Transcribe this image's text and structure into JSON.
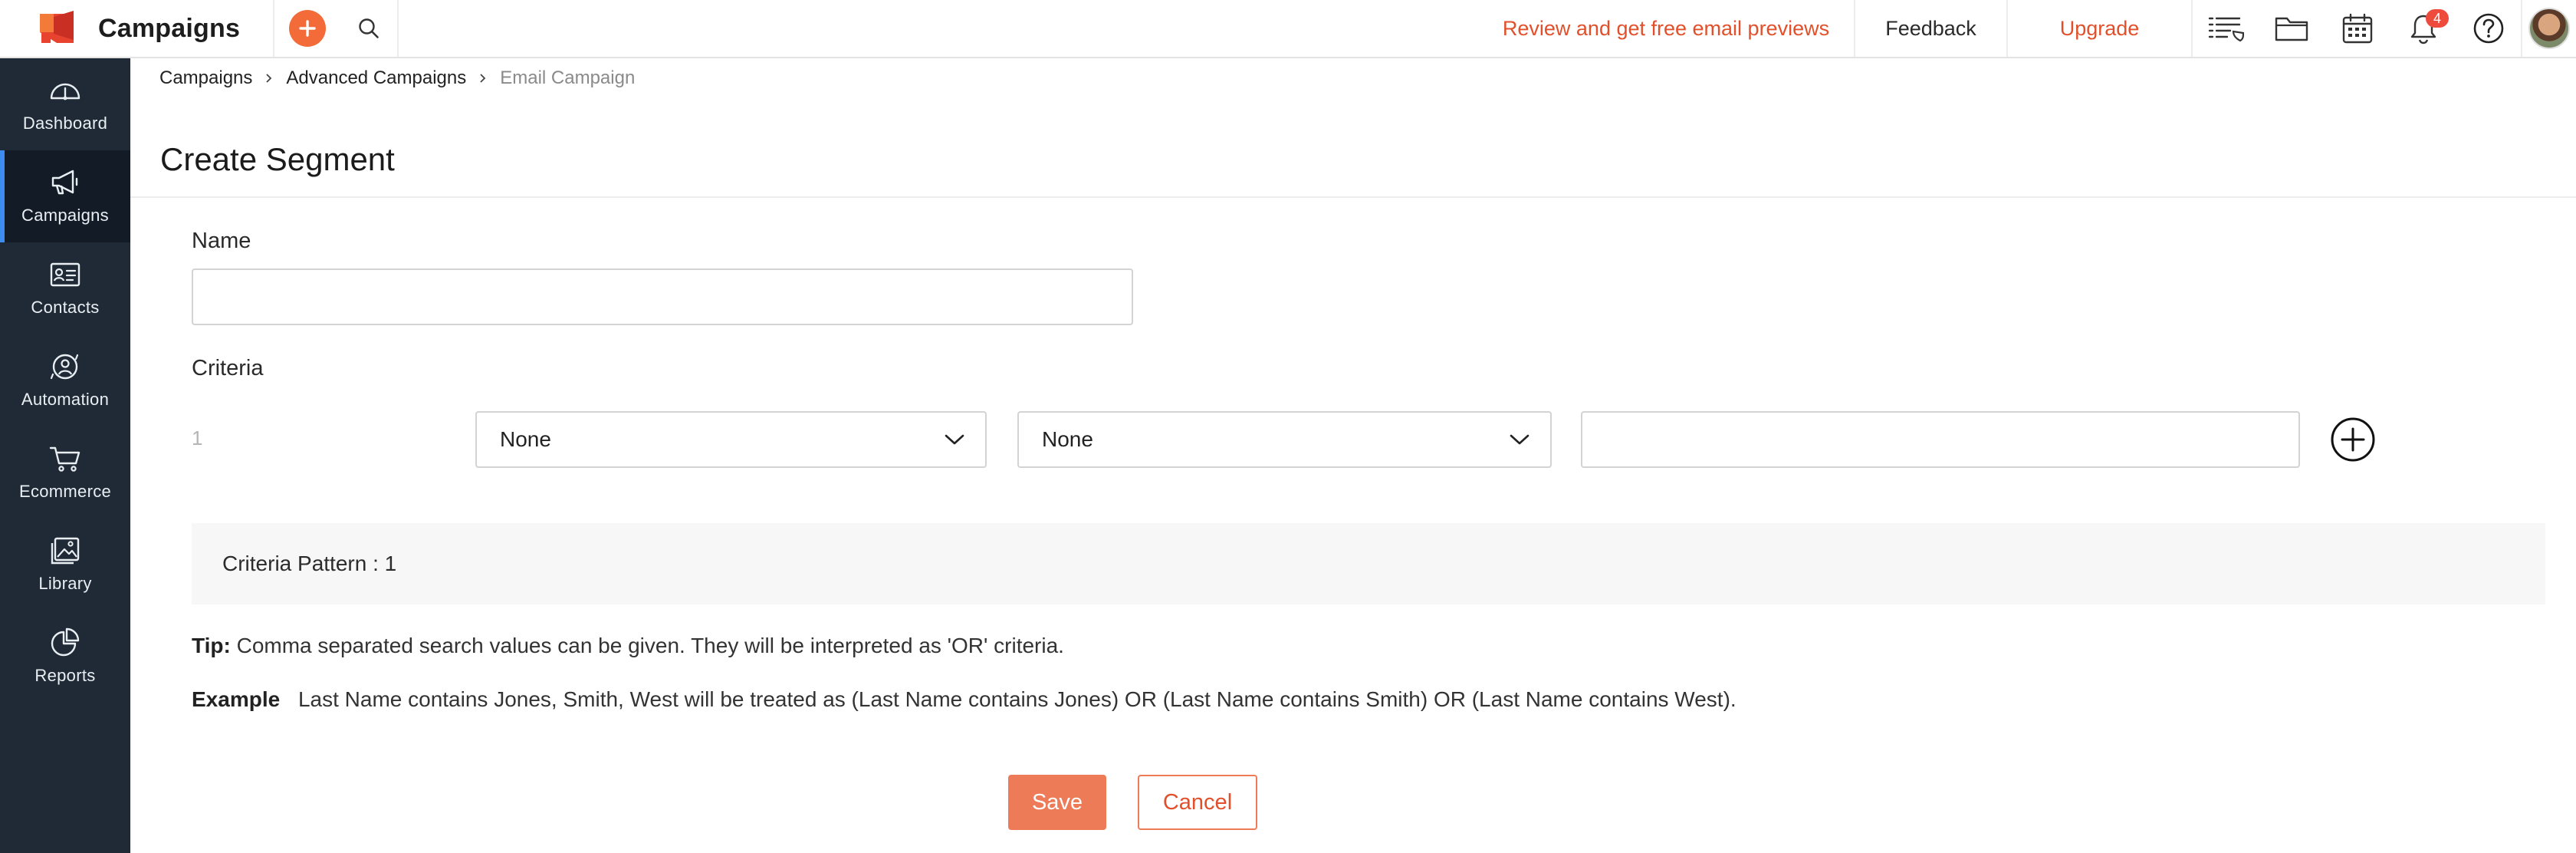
{
  "header": {
    "app_name": "Campaigns",
    "promo_link": "Review and get free email previews",
    "feedback_label": "Feedback",
    "upgrade_label": "Upgrade",
    "notification_count": "4",
    "accent_color": "#f26b38",
    "icons": [
      "plus-icon",
      "search-icon",
      "list-icon",
      "folder-icon",
      "calendar-icon",
      "bell-icon",
      "help-icon"
    ]
  },
  "sidebar": {
    "items": [
      {
        "label": "Dashboard",
        "icon": "gauge-icon",
        "active": false
      },
      {
        "label": "Campaigns",
        "icon": "megaphone-icon",
        "active": true
      },
      {
        "label": "Contacts",
        "icon": "contact-card-icon",
        "active": false
      },
      {
        "label": "Automation",
        "icon": "automation-icon",
        "active": false
      },
      {
        "label": "Ecommerce",
        "icon": "cart-icon",
        "active": false
      },
      {
        "label": "Library",
        "icon": "image-library-icon",
        "active": false
      },
      {
        "label": "Reports",
        "icon": "pie-chart-icon",
        "active": false
      }
    ]
  },
  "breadcrumb": {
    "items": [
      "Campaigns",
      "Advanced Campaigns",
      "Email Campaign"
    ]
  },
  "page": {
    "title": "Create Segment"
  },
  "form": {
    "name_label": "Name",
    "name_value": "",
    "criteria_label": "Criteria",
    "criteria_rows": [
      {
        "number": "1",
        "field": "None",
        "condition": "None",
        "value": ""
      }
    ],
    "pattern_text": "Criteria Pattern : 1",
    "tip_label": "Tip:",
    "tip_text": "Comma separated search values can be given. They will be interpreted as 'OR' criteria.",
    "example_label": "Example",
    "example_text": "Last Name contains Jones, Smith, West will be treated as (Last Name contains Jones) OR (Last Name contains Smith) OR (Last Name contains West).",
    "save_label": "Save",
    "cancel_label": "Cancel"
  }
}
